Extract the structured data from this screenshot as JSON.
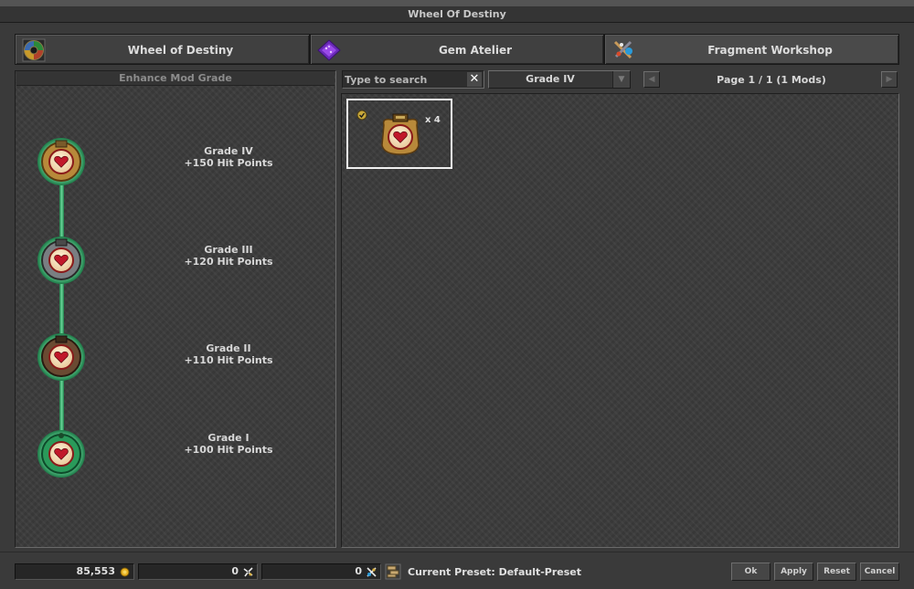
{
  "window": {
    "title": "Wheel Of Destiny"
  },
  "tabs": [
    {
      "label": "Wheel of Destiny",
      "icon": "wheel-icon",
      "active": false
    },
    {
      "label": "Gem Atelier",
      "icon": "gem-icon",
      "active": false
    },
    {
      "label": "Fragment Workshop",
      "icon": "fragment-tools-icon",
      "active": true
    }
  ],
  "left_panel": {
    "title": "Enhance Mod Grade",
    "grades": [
      {
        "name": "Grade IV",
        "bonus": "+150 Hit Points",
        "frame": "gold"
      },
      {
        "name": "Grade III",
        "bonus": "+120 Hit Points",
        "frame": "silver"
      },
      {
        "name": "Grade II",
        "bonus": "+110 Hit Points",
        "frame": "bronze"
      },
      {
        "name": "Grade I",
        "bonus": "+100 Hit Points",
        "frame": "green"
      }
    ]
  },
  "search": {
    "placeholder": "Type to search",
    "value": ""
  },
  "grade_filter": {
    "selected": "Grade IV"
  },
  "pagination": {
    "label": "Page 1 / 1 (1 Mods)"
  },
  "mods": [
    {
      "count": "x 4",
      "icon": "heart-mod-icon",
      "selected": true
    }
  ],
  "bottom": {
    "gold": "85,553",
    "lesser_fragments": "0",
    "greater_fragments": "0",
    "preset": "Current Preset: Default-Preset",
    "buttons": {
      "ok": "Ok",
      "apply": "Apply",
      "reset": "Reset",
      "cancel": "Cancel"
    }
  },
  "colors": {
    "panel_bg": "#3b3b3b",
    "connector_green": "#3ab86a",
    "selected_border": "#f0f0f0",
    "gold_frame": "#b8893a",
    "heart_red": "#c0182a"
  }
}
